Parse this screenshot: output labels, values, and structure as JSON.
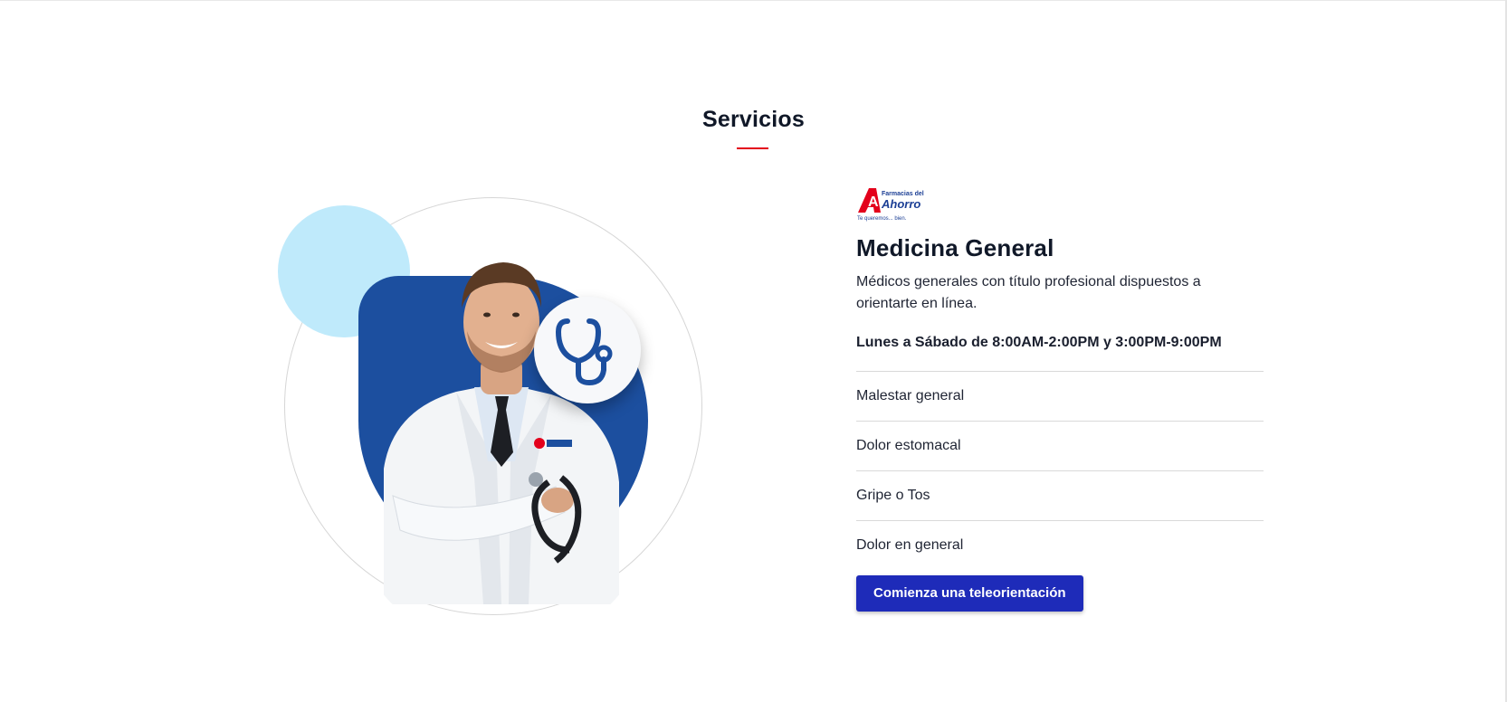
{
  "section": {
    "title": "Servicios"
  },
  "brand": {
    "logo_letter": "A",
    "logo_line1": "Farmacias del",
    "logo_line2": "Ahorro",
    "logo_tagline": "Te queremos... bien."
  },
  "service": {
    "title": "Medicina General",
    "description": "Médicos generales con título profesional dispuestos a orientarte en línea.",
    "schedule": "Lunes a Sábado de 8:00AM-2:00PM y 3:00PM-9:00PM",
    "symptoms": [
      "Malestar general",
      "Dolor estomacal",
      "Gripe o Tos",
      "Dolor en general"
    ],
    "cta_label": "Comienza una teleorientación"
  },
  "illustration": {
    "icon": "stethoscope-icon",
    "subject": "doctor-photo"
  },
  "colors": {
    "accent_red": "#e3001b",
    "brand_blue": "#1c4f9f",
    "button_blue": "#1e2bb9",
    "light_blue": "#bfeafb",
    "text_dark": "#101828"
  }
}
